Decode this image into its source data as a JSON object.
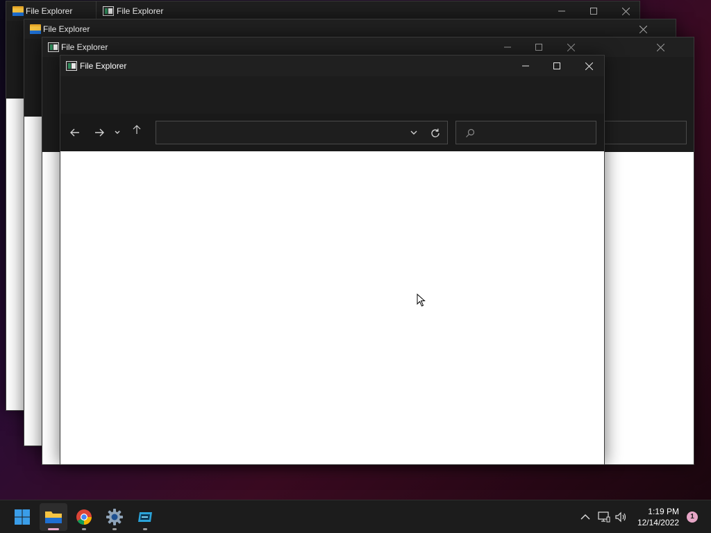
{
  "windows": {
    "back1": {
      "title": "File Explorer"
    },
    "back1b": {
      "title": "File Explorer"
    },
    "back2": {
      "title": "File Explorer"
    },
    "back3": {
      "title": "File Explorer"
    },
    "main": {
      "title": "File Explorer",
      "address_value": "",
      "search_value": ""
    }
  },
  "icons": {
    "back": "back-arrow-icon",
    "forward": "forward-arrow-icon",
    "recent": "chevron-down-icon",
    "up": "up-arrow-icon",
    "refresh": "refresh-icon",
    "search": "search-icon"
  },
  "taskbar": {
    "apps": [
      {
        "name": "Start",
        "icon": "windows-logo-icon"
      },
      {
        "name": "File Explorer",
        "icon": "folder-icon",
        "state": "active"
      },
      {
        "name": "Chrome",
        "icon": "chrome-icon",
        "state": "open"
      },
      {
        "name": "Settings",
        "icon": "gear-icon",
        "state": "open"
      },
      {
        "name": "Virtual Drive",
        "icon": "drive-icon",
        "state": "open"
      }
    ],
    "time": "1:19 PM",
    "date": "12/14/2022",
    "notification_count": "1"
  },
  "colors": {
    "accent": "#e7a6c7",
    "titlebar": "#202020",
    "toolbar": "#1c1c1c",
    "content": "#ffffff"
  }
}
